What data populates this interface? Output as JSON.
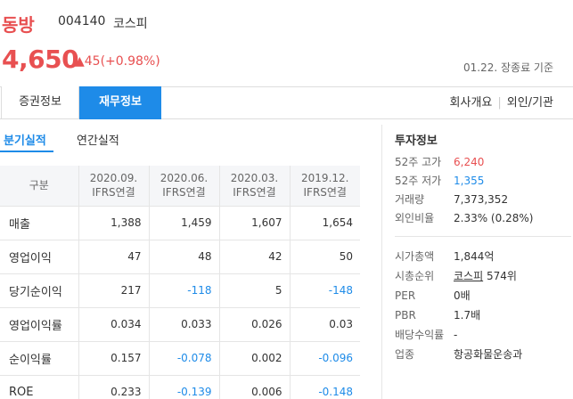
{
  "stock": {
    "name": "동방",
    "code": "004140",
    "market": "코스피",
    "price": "4,650",
    "change": "▲45(+0.98%)",
    "date": "01.22. 장종료 기준"
  },
  "tabs": {
    "stock_info": "증권정보",
    "finance_info": "재무정보",
    "company": "회사개요",
    "foreign": "외인/기관"
  },
  "subtabs": {
    "quarterly": "분기실적",
    "annual": "연간실적"
  },
  "table": {
    "header_label": "구분",
    "columns": [
      {
        "period": "2020.09.",
        "std": "IFRS연결"
      },
      {
        "period": "2020.06.",
        "std": "IFRS연결"
      },
      {
        "period": "2020.03.",
        "std": "IFRS연결"
      },
      {
        "period": "2019.12.",
        "std": "IFRS연결"
      }
    ],
    "rows": [
      {
        "label": "매출",
        "values": [
          "1,388",
          "1,459",
          "1,607",
          "1,654"
        ]
      },
      {
        "label": "영업이익",
        "values": [
          "47",
          "48",
          "42",
          "50"
        ]
      },
      {
        "label": "당기순이익",
        "values": [
          "217",
          "-118",
          "5",
          "-148"
        ]
      },
      {
        "label": "영업이익률",
        "values": [
          "0.034",
          "0.033",
          "0.026",
          "0.03"
        ]
      },
      {
        "label": "순이익률",
        "values": [
          "0.157",
          "-0.078",
          "0.002",
          "-0.096"
        ]
      },
      {
        "label": "ROE",
        "values": [
          "0.233",
          "-0.139",
          "0.006",
          "-0.148"
        ]
      }
    ]
  },
  "investment": {
    "title": "투자정보",
    "high52": {
      "label": "52주 고가",
      "value": "6,240"
    },
    "low52": {
      "label": "52주 저가",
      "value": "1,355"
    },
    "volume": {
      "label": "거래량",
      "value": "7,373,352"
    },
    "foreign_ratio": {
      "label": "외인비율",
      "value": "2.33% (0.28%)"
    },
    "market_cap": {
      "label": "시가총액",
      "value": "1,844억"
    },
    "rank": {
      "label": "시총순위",
      "link": "코스피",
      "value": "574위"
    },
    "per": {
      "label": "PER",
      "value": "0배"
    },
    "pbr": {
      "label": "PBR",
      "value": "1.7배"
    },
    "dividend": {
      "label": "배당수익률",
      "value": "-"
    },
    "industry": {
      "label": "업종",
      "value": "항공화물운송과"
    }
  },
  "colors": {
    "up": "#e85051",
    "down": "#1e8be8",
    "accent": "#1e8be8"
  }
}
